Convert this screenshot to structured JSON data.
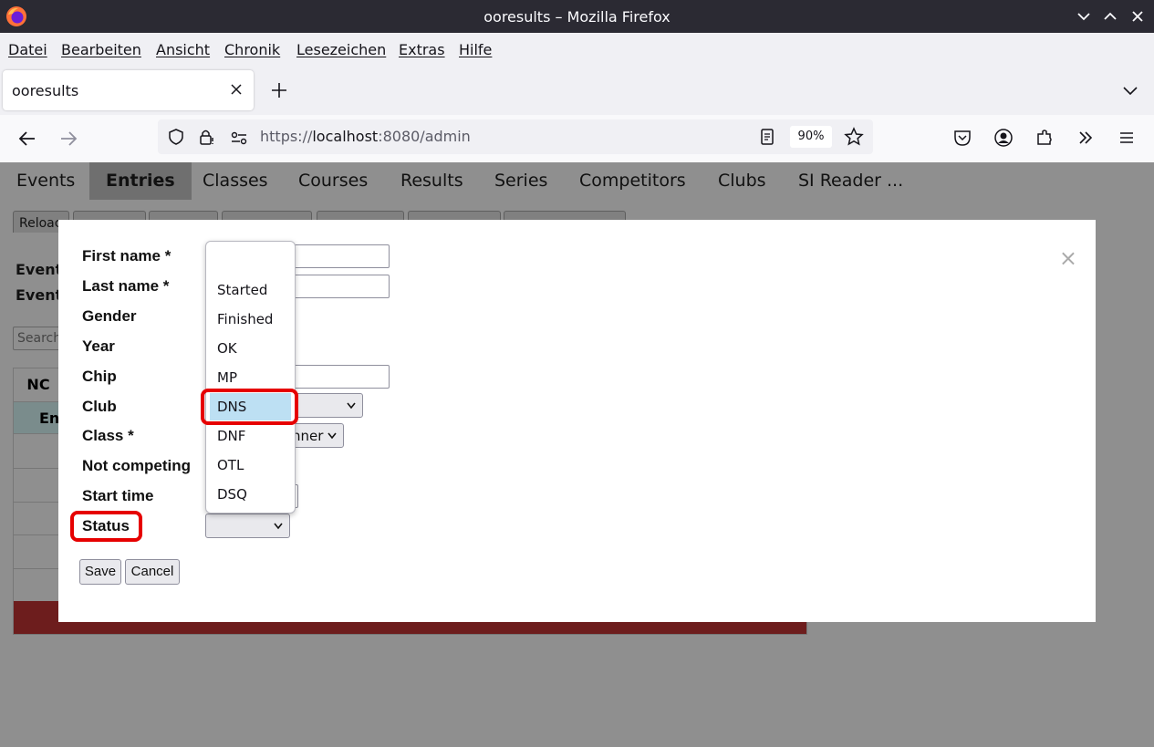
{
  "window": {
    "title": "ooresults – Mozilla Firefox"
  },
  "menu": [
    "Datei",
    "Bearbeiten",
    "Ansicht",
    "Chronik",
    "Lesezeichen",
    "Extras",
    "Hilfe"
  ],
  "tab": {
    "label": "ooresults"
  },
  "url": {
    "scheme": "https://",
    "host": "localhost",
    "rest": ":8080/admin"
  },
  "zoom": "90%",
  "page_nav": [
    "Events",
    "Entries",
    "Classes",
    "Courses",
    "Results",
    "Series",
    "Competitors",
    "Clubs",
    "SI Reader ..."
  ],
  "page_nav_active": "Entries",
  "background": {
    "reload_button": "Reloac",
    "event_label_1": "Event",
    "event_label_2": "Event",
    "search_placeholder": "Search",
    "table_header": "NC",
    "table_row_label": "En"
  },
  "form": {
    "first_name": "First name *",
    "last_name": "Last name *",
    "gender": "Gender",
    "year": "Year",
    "chip": "Chip",
    "club": "Club",
    "class": "Class *",
    "class_value": "nner",
    "not_competing": "Not competing",
    "start_time": "Start time",
    "status": "Status",
    "save": "Save",
    "cancel": "Cancel",
    "close": "×"
  },
  "status_options": [
    "",
    "Started",
    "Finished",
    "OK",
    "MP",
    "DNS",
    "DNF",
    "OTL",
    "DSQ"
  ],
  "status_highlighted": "DNS",
  "colors": {
    "highlight": "#e60000",
    "selected_option": "#bde0f3",
    "table_footer": "#6d1d1d"
  }
}
